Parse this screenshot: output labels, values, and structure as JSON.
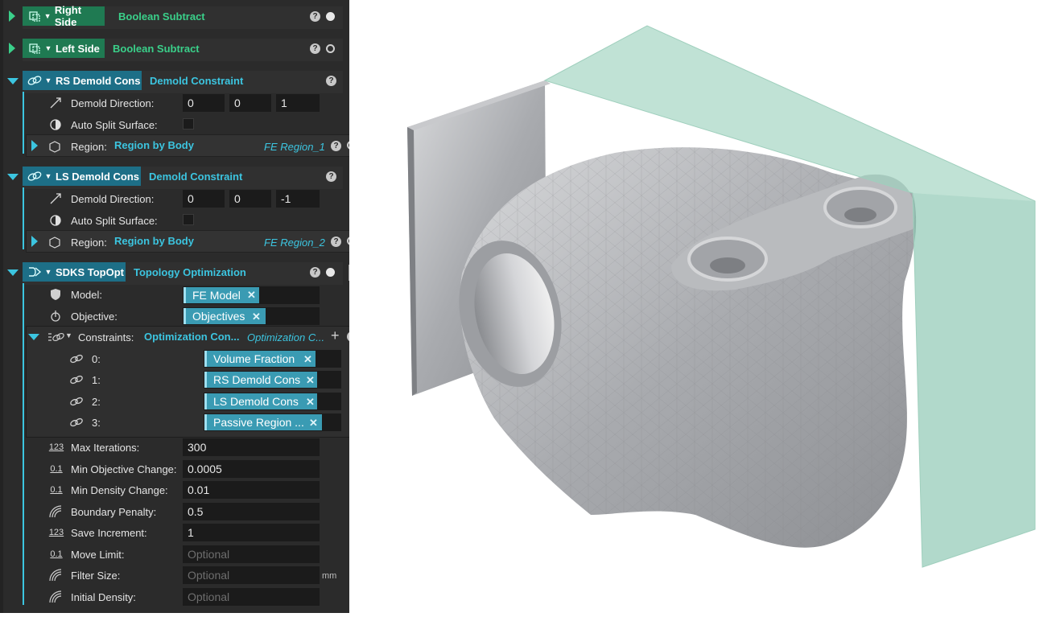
{
  "nodes": [
    {
      "name": "Right Side",
      "type": "Boolean Subtract",
      "help": "?"
    },
    {
      "name": "Left Side",
      "type": "Boolean Subtract",
      "help": "?"
    },
    {
      "name": "RS Demold Cons",
      "type": "Demold Constraint",
      "help": "?",
      "demold_label": "Demold Direction:",
      "dir": [
        "0",
        "0",
        "1"
      ],
      "auto_split_label": "Auto Split Surface:",
      "region_label": "Region:",
      "region_link": "Region by Body",
      "region_value": "FE Region_1"
    },
    {
      "name": "LS Demold Cons",
      "type": "Demold Constraint",
      "help": "?",
      "demold_label": "Demold Direction:",
      "dir": [
        "0",
        "0",
        "-1"
      ],
      "auto_split_label": "Auto Split Surface:",
      "region_label": "Region:",
      "region_link": "Region by Body",
      "region_value": "FE Region_2"
    },
    {
      "name": "SDKS TopOpt",
      "type": "Topology Optimization",
      "help": "?",
      "model_label": "Model:",
      "model_value": "FE Model",
      "objective_label": "Objective:",
      "objective_value": "Objectives",
      "constraints_label": "Constraints:",
      "constraints_link": "Optimization Con...",
      "constraints_value": "Optimization C...",
      "constraint_items": [
        {
          "index": "0:",
          "value": "Volume Fraction"
        },
        {
          "index": "1:",
          "value": "RS Demold Cons"
        },
        {
          "index": "2:",
          "value": "LS Demold Cons"
        },
        {
          "index": "3:",
          "value": "Passive Region ..."
        }
      ],
      "params": [
        {
          "label": "Max Iterations:",
          "value": "300",
          "icon": "123",
          "placeholder": false
        },
        {
          "label": "Min Objective Change:",
          "value": "0.0005",
          "icon": "0.1",
          "placeholder": false
        },
        {
          "label": "Min Density Change:",
          "value": "0.01",
          "icon": "0.1",
          "placeholder": false
        },
        {
          "label": "Boundary Penalty:",
          "value": "0.5",
          "icon": "arc",
          "placeholder": false
        },
        {
          "label": "Save Increment:",
          "value": "1",
          "icon": "123",
          "placeholder": false
        },
        {
          "label": "Move Limit:",
          "value": "Optional",
          "icon": "0.1",
          "placeholder": true
        },
        {
          "label": "Filter Size:",
          "value": "Optional",
          "icon": "arc",
          "placeholder": true,
          "unit": "mm"
        },
        {
          "label": "Initial Density:",
          "value": "Optional",
          "icon": "arc",
          "placeholder": true
        }
      ]
    }
  ],
  "colors": {
    "panel": "#2b2b2b",
    "green_accent": "#3ad08a",
    "blue_accent": "#3cc5e0",
    "tag": "#3a9bb3",
    "mold": "#8fc9b3",
    "part": "#a9abaf"
  },
  "viewport": {
    "description_icon": "3d-model-view"
  }
}
